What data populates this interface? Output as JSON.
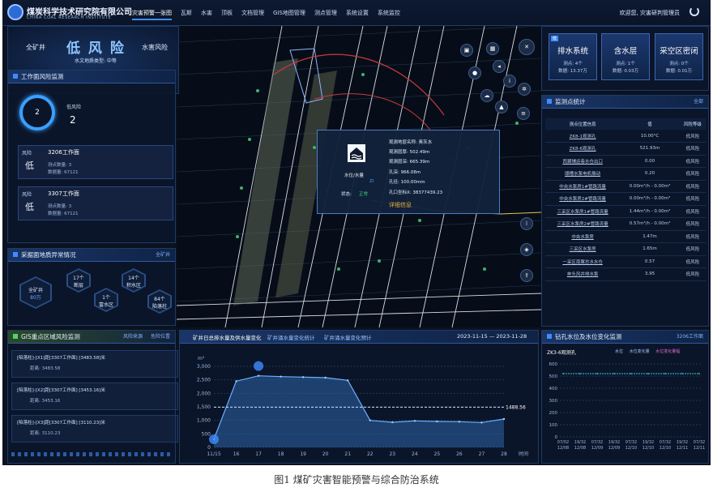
{
  "header": {
    "org_cn": "煤炭科学技术研究院有限公司",
    "org_en": "CHINA COAL RESEARCH INSTITUTE",
    "nav": [
      "灾害预警一张图",
      "瓦斯",
      "水害",
      "顶板",
      "文档管理",
      "GIS地图管理",
      "测点管理",
      "系统设置",
      "系统监控"
    ],
    "welcome": "欢迎您, 灾害研判管理员"
  },
  "risk": {
    "left_label": "全矿井",
    "level": "低 风 险",
    "right_label": "水害风险",
    "subtitle": "水文地质类型: 中等"
  },
  "workface": {
    "title": "工作面风险监测",
    "ring_value": "2",
    "low_label": "低风险",
    "low_count": "2",
    "cards": [
      {
        "tag": "风险",
        "level": "低",
        "name": "3206工作面",
        "r1": "测点数量: 3",
        "r2": "数据量: 67121"
      },
      {
        "tag": "风险",
        "level": "低",
        "name": "3307工作面",
        "r1": "测点数量: 3",
        "r2": "数据量: 67121"
      }
    ]
  },
  "geology": {
    "title": "采掘面地质异常情况",
    "filter": "全矿井",
    "center_label": "全矿井",
    "center_sub": "80万",
    "hexes": [
      {
        "n": "17个",
        "t": "断层"
      },
      {
        "n": "14个",
        "t": "积水区"
      },
      {
        "n": "1个",
        "t": "富水区"
      },
      {
        "n": "84个",
        "t": "陷落柱"
      }
    ]
  },
  "gis": {
    "title": "GIS重点区域风险监测",
    "legend1": "风险来源",
    "legend2": "危险位置",
    "items": [
      {
        "l1": "[陷落柱]-[X1]距[3307工作面] [3483.58]米",
        "l2": "距离: 3483.58"
      },
      {
        "l1": "[陷落柱]-[X2]距[3307工作面] [3453.16]米",
        "l2": "距离: 3453.16"
      },
      {
        "l1": "[陷落柱]-[X3]距[3307工作面] [3110.23]米",
        "l2": "距离: 3110.23"
      }
    ]
  },
  "popup": {
    "icon_label": "水位/水量",
    "status_label": "状态:",
    "status": "正常",
    "fields": [
      "观测地层名称: 奥灰水",
      "观测层厚: 502.49m",
      "观测层深: 665.39m",
      "孔深: 966.08m",
      "孔径: 100.00mm",
      "孔口坐标X: 38377439.23"
    ],
    "detail": "详细信息",
    "z_label": "ZI"
  },
  "stats": {
    "tag": "低",
    "cards": [
      {
        "title": "排水系统",
        "a": "测点: 4个",
        "b": "数据: 13.37万"
      },
      {
        "title": "含水层",
        "a": "测点: 1个",
        "b": "数据: 0.03万"
      },
      {
        "title": "采空区密闭",
        "a": "测点: 0个",
        "b": "数据: 0.01万"
      }
    ]
  },
  "monitor": {
    "title": "监测点统计",
    "filter": "全部",
    "headers": [
      "测点位置信息",
      "值",
      "风险等级"
    ],
    "rows": [
      [
        "ZK8-1观测孔",
        "10.00°C",
        "低风险"
      ],
      [
        "ZK8-6观测孔",
        "521.93m",
        "低风险"
      ],
      [
        "西翼辅运巷水仓出口",
        "0.00",
        "低风险"
      ],
      [
        "顺槽水泵电机振动",
        "0.20",
        "低风险"
      ],
      [
        "中央水泵房1#管路流量",
        "0.00m³/h - 0.00m³",
        "低风险"
      ],
      [
        "中央水泵房2#管路流量",
        "0.00m³/h - 0.00m³",
        "低风险"
      ],
      [
        "三采区水泵房1#管路流量",
        "1.44m³/h - 0.00m³",
        "低风险"
      ],
      [
        "三采区水泵房2#管路流量",
        "0.57m³/h - 0.00m³",
        "低风险"
      ],
      [
        "中央水泵房",
        "1.47m",
        "低风险"
      ],
      [
        "三采区水泵房",
        "1.65m",
        "低风险"
      ],
      [
        "一采区南翼总水水仓",
        "0.57",
        "低风险"
      ],
      [
        "奔头风井排水泵",
        "3.95",
        "低风险"
      ]
    ]
  },
  "flow": {
    "tabs": [
      "矿井日总排水量及供水量变化",
      "矿井涌水量变化统计",
      "矿井涌水量变化预计"
    ],
    "date_range": "2023-11-15 — 2023-11-28",
    "point_label": "11/15",
    "end_label": "1488.56"
  },
  "borehole": {
    "title": "钻孔水位及水位变化监测",
    "filter": "3206工作面",
    "name": "ZK3-6观测孔",
    "legend": [
      "水位",
      "水位变化量",
      "水位变化量幅"
    ]
  },
  "chart_data": [
    {
      "type": "area",
      "title": "",
      "ylabel": "m³",
      "xlabel": "时间",
      "x": [
        "11/15",
        "16",
        "17",
        "18",
        "19",
        "20",
        "21",
        "22",
        "23",
        "24",
        "25",
        "26",
        "27",
        "28"
      ],
      "yticks": [
        "0",
        "500",
        "1,000",
        "1,500",
        "2,000",
        "2,500",
        "3,000"
      ],
      "ylim": [
        0,
        3000
      ],
      "series": [
        {
          "values": [
            300,
            2450,
            2650,
            2620,
            2600,
            2580,
            2480,
            1000,
            930,
            980,
            960,
            950,
            920,
            1050
          ]
        }
      ],
      "reference_line": 1488.56
    },
    {
      "type": "line",
      "title": "",
      "ylabel": "m",
      "yticks": [
        "0",
        "100",
        "200",
        "300",
        "400",
        "500",
        "600"
      ],
      "ylim": [
        0,
        600
      ],
      "x": [
        "07/02 12/08",
        "19/32 12/08",
        "07/32 12/09",
        "19/32 12/09",
        "07/32 12/10",
        "19/32 12/10",
        "07/32 12/10",
        "19/32 12/11",
        "07/32 12/11"
      ],
      "series": [
        {
          "values": [
            520,
            520,
            520,
            520,
            520,
            520,
            520,
            520,
            520
          ]
        }
      ]
    }
  ],
  "caption": "图1   煤矿灾害智能预警与综合防治系统"
}
